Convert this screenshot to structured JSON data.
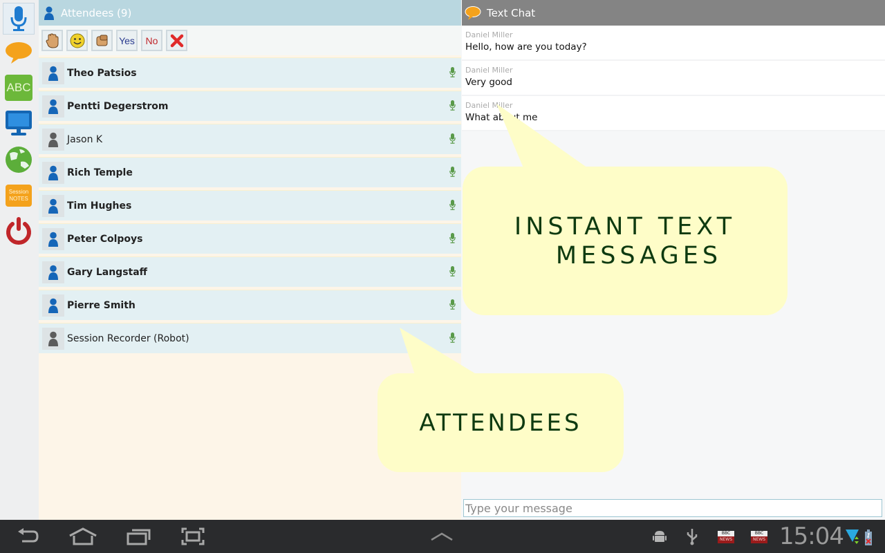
{
  "rail": {
    "items": [
      {
        "name": "microphone",
        "active": true
      },
      {
        "name": "chat"
      },
      {
        "name": "whiteboard",
        "label": "ABC"
      },
      {
        "name": "screen-share"
      },
      {
        "name": "web-browser"
      },
      {
        "name": "session-notes",
        "label_line1": "Session",
        "label_line2": "NOTES"
      },
      {
        "name": "power"
      }
    ]
  },
  "attendees": {
    "title": "Attendees (9)",
    "toolbar": [
      {
        "name": "raise-hand"
      },
      {
        "name": "smile"
      },
      {
        "name": "applause"
      },
      {
        "name": "yes",
        "label": "Yes"
      },
      {
        "name": "no",
        "label": "No"
      },
      {
        "name": "clear"
      }
    ],
    "list": [
      {
        "name": "Theo Patsios",
        "role": "presenter"
      },
      {
        "name": "Pentti Degerstrom",
        "role": "presenter"
      },
      {
        "name": "Jason K",
        "role": "guest"
      },
      {
        "name": "Rich Temple",
        "role": "presenter"
      },
      {
        "name": "Tim Hughes",
        "role": "presenter"
      },
      {
        "name": "Peter Colpoys",
        "role": "presenter"
      },
      {
        "name": "Gary Langstaff",
        "role": "presenter"
      },
      {
        "name": "Pierre Smith",
        "role": "presenter"
      },
      {
        "name": "Session Recorder (Robot)",
        "role": "guest"
      }
    ]
  },
  "chat": {
    "title": "Text Chat",
    "messages": [
      {
        "sender": "Daniel Miller",
        "text": "Hello, how are you today?"
      },
      {
        "sender": "Daniel Miller",
        "text": "Very good"
      },
      {
        "sender": "Daniel Miller",
        "text": "What about me"
      }
    ],
    "input_placeholder": "Type your message"
  },
  "callouts": {
    "messages_line1": "INSTANT TEXT",
    "messages_line2": "MESSAGES",
    "attendees": "ATTENDEES"
  },
  "status_bar": {
    "time": "15:04",
    "news_label_top": "BBC",
    "news_label_bottom": "NEWS"
  },
  "colors": {
    "attendees_header": "#b9d7e0",
    "chat_header": "#848484",
    "callout_bg": "#fefdc8",
    "callout_text": "#0e3a10",
    "mic_green": "#5a9a4a"
  }
}
